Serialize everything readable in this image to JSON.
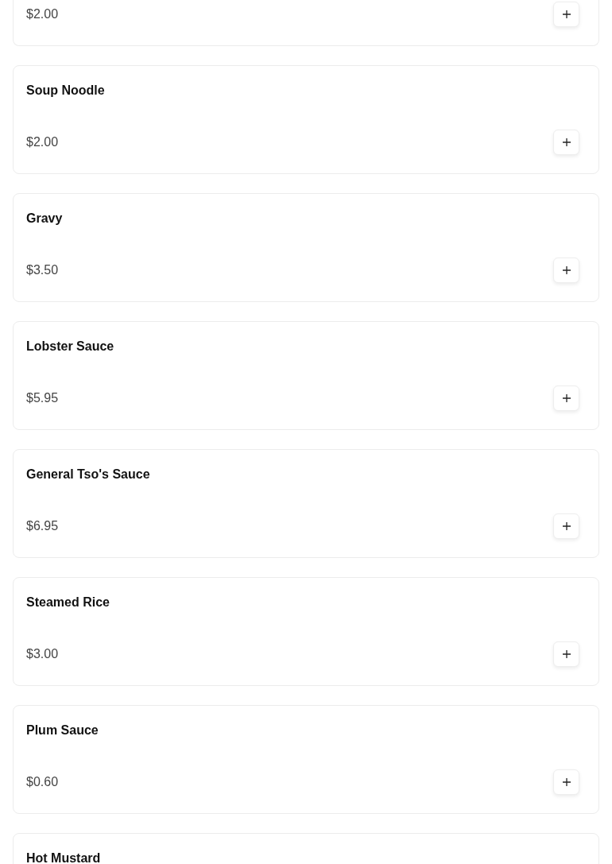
{
  "items": [
    {
      "price": "$2.00"
    },
    {
      "name": "Soup Noodle",
      "price": "$2.00"
    },
    {
      "name": "Gravy",
      "price": "$3.50"
    },
    {
      "name": "Lobster Sauce",
      "price": "$5.95"
    },
    {
      "name": "General Tso's Sauce",
      "price": "$6.95"
    },
    {
      "name": "Steamed Rice",
      "price": "$3.00"
    },
    {
      "name": "Plum Sauce",
      "price": "$0.60"
    },
    {
      "name": "Hot Mustard"
    }
  ]
}
